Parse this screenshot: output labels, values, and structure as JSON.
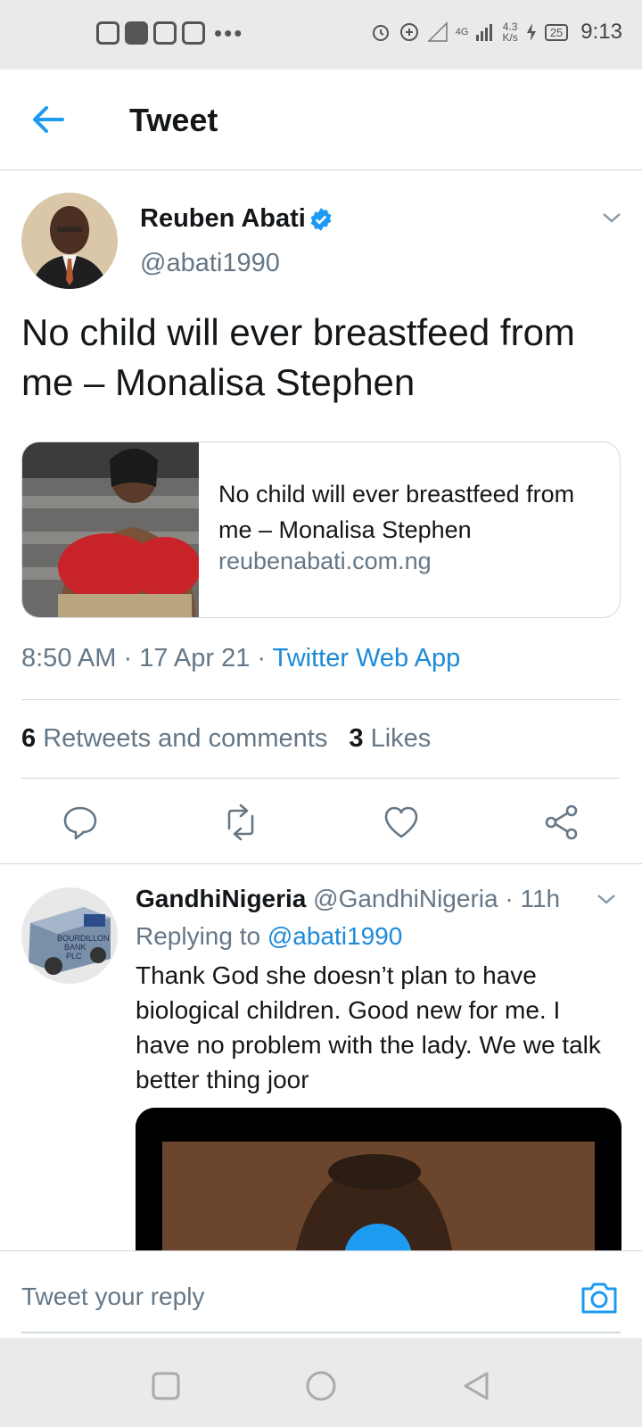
{
  "status_bar": {
    "time": "9:13",
    "battery": "25",
    "network": "4G",
    "speed_value": "4.3",
    "speed_unit": "K/s"
  },
  "header": {
    "title": "Tweet"
  },
  "tweet": {
    "author_name": "Reuben Abati",
    "author_handle": "@abati1990",
    "text": "No child will ever breastfeed from me – Monalisa Stephen",
    "card": {
      "title": "No child will ever breastfeed from me – Monalisa Stephen",
      "domain": "reubenabati.com.ng"
    },
    "time": "8:50 AM",
    "date": "17 Apr 21",
    "source": "Twitter Web App",
    "retweets_count": "6",
    "retweets_label": "Retweets and comments",
    "likes_count": "3",
    "likes_label": "Likes"
  },
  "reply": {
    "author_name": "GandhiNigeria",
    "author_handle": "@GandhiNigeria",
    "age": "11h",
    "replying_to_label": "Replying to",
    "replying_to_handle": "@abati1990",
    "text": "Thank God she doesn’t plan to have biological children.  Good new for me.  I have no problem with the lady.  We we talk better thing joor",
    "avatar_text_line1": "BOURDILLON",
    "avatar_text_line2": "BANK",
    "avatar_text_line3": "PLC"
  },
  "reply_bar": {
    "placeholder": "Tweet your reply"
  },
  "colors": {
    "accent": "#1d9bf0",
    "link": "#1d8ad8",
    "muted": "#657786",
    "divider": "#d6d6d6"
  }
}
